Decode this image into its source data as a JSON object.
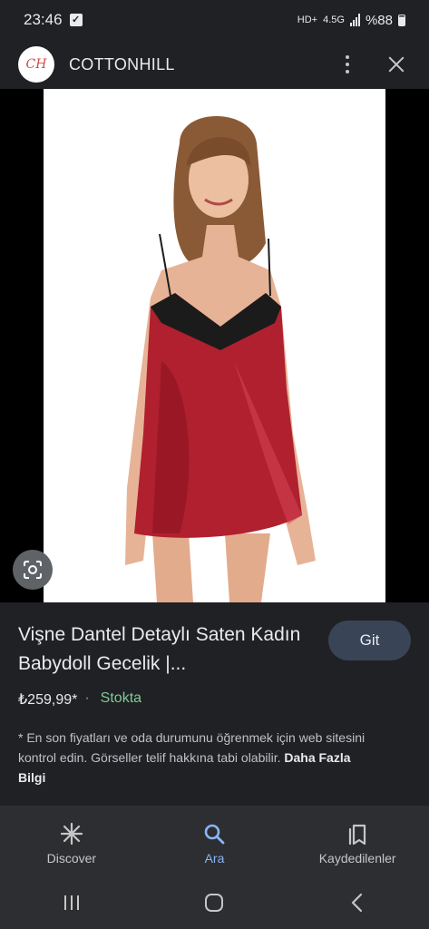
{
  "status_bar": {
    "time": "23:46",
    "network_label": "4.5G",
    "battery_text": "%88"
  },
  "app_bar": {
    "logo_text": "CH",
    "site_name": "COTTONHILL"
  },
  "image": {
    "alt": "Woman wearing a red satin babydoll with black lace trim"
  },
  "product": {
    "title": "Vişne Dantel Detaylı Saten Kadın Babydoll Gecelik |...",
    "go_button": "Git",
    "price": "₺259,99*",
    "separator": "·",
    "stock": "Stokta",
    "note_text": "* En son fiyatları ve oda durumunu öğrenmek için web sitesini kontrol edin. Görseller telif hakkına tabi olabilir.",
    "more_info_link": "Daha Fazla Bilgi"
  },
  "bottom_nav": {
    "items": [
      {
        "label": "Discover",
        "icon": "asterisk-icon"
      },
      {
        "label": "Ara",
        "icon": "search-icon"
      },
      {
        "label": "Kaydedilenler",
        "icon": "bookmarks-icon"
      }
    ]
  },
  "colors": {
    "background": "#202124",
    "accent": "#8ab4f8",
    "stock_green": "#81c995",
    "button_bg": "#394457"
  }
}
